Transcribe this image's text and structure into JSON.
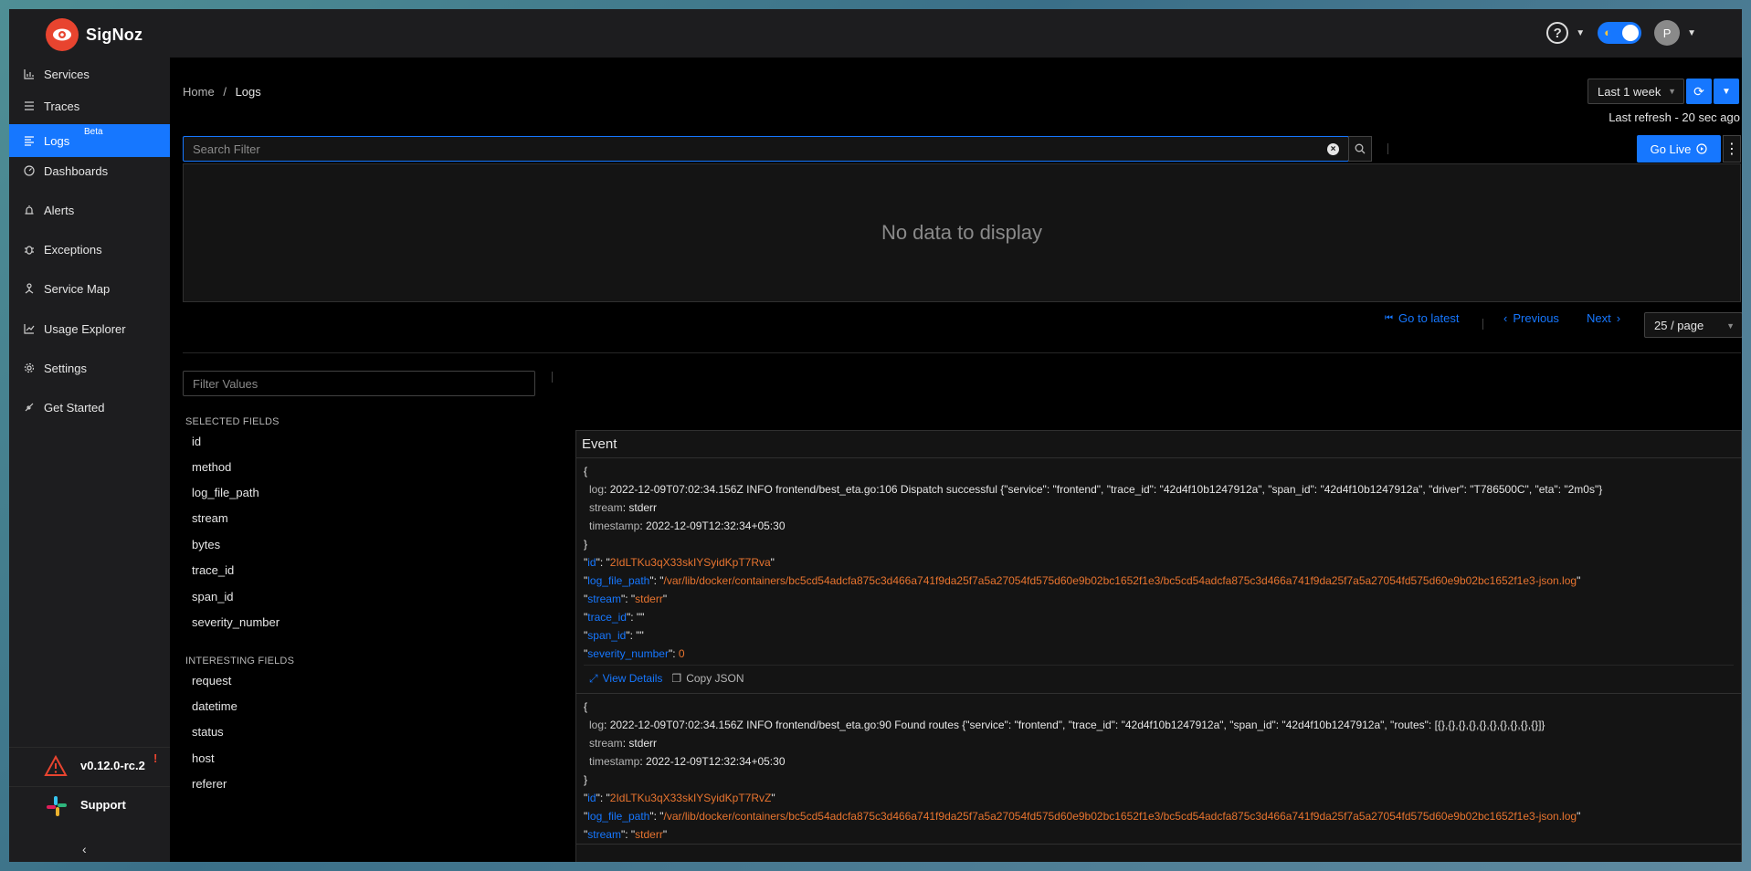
{
  "brand": {
    "name": "SigNoz"
  },
  "topbar": {
    "avatar_initial": "P"
  },
  "sidebar": {
    "items": [
      {
        "label": "Services",
        "icon": "bar-chart-icon"
      },
      {
        "label": "Traces",
        "icon": "list-icon"
      },
      {
        "label": "Logs",
        "icon": "align-left-icon",
        "badge": "Beta"
      },
      {
        "label": "Dashboards",
        "icon": "dashboard-icon"
      },
      {
        "label": "Alerts",
        "icon": "alert-icon"
      },
      {
        "label": "Exceptions",
        "icon": "bug-icon"
      },
      {
        "label": "Service Map",
        "icon": "deployment-icon"
      },
      {
        "label": "Usage Explorer",
        "icon": "line-chart-icon"
      },
      {
        "label": "Settings",
        "icon": "gear-icon"
      },
      {
        "label": "Get Started",
        "icon": "api-icon"
      }
    ],
    "version": "v0.12.0-rc.2",
    "version_flag": "!",
    "support": "Support"
  },
  "breadcrumb": {
    "home": "Home",
    "separator": "/",
    "current": "Logs"
  },
  "time": {
    "selected": "Last 1 week",
    "last_refresh": "Last refresh - 20 sec ago"
  },
  "search": {
    "placeholder": "Search Filter",
    "value": ""
  },
  "go_live": "Go Live",
  "chart": {
    "empty": "No data to display"
  },
  "pager": {
    "latest": "Go to latest",
    "previous": "Previous",
    "next": "Next",
    "page_size": "25 / page"
  },
  "filter": {
    "placeholder": "Filter Values"
  },
  "selected_fields": {
    "heading": "SELECTED FIELDS",
    "items": [
      "id",
      "method",
      "log_file_path",
      "stream",
      "bytes",
      "trace_id",
      "span_id",
      "severity_number"
    ]
  },
  "interesting_fields": {
    "heading": "INTERESTING FIELDS",
    "items": [
      "request",
      "datetime",
      "status",
      "host",
      "referer"
    ]
  },
  "events": {
    "header": "Event",
    "view_details": "View Details",
    "copy_json": "Copy JSON",
    "logs": [
      {
        "log": "2022-12-09T07:02:34.156Z INFO frontend/best_eta.go:106 Dispatch successful {\"service\": \"frontend\", \"trace_id\": \"42d4f10b1247912a\", \"span_id\": \"42d4f10b1247912a\", \"driver\": \"T786500C\", \"eta\": \"2m0s\"}",
        "stream": "stderr",
        "timestamp": "2022-12-09T12:32:34+05:30",
        "id": "2IdLTKu3qX33skIYSyidKpT7Rva",
        "log_file_path": "/var/lib/docker/containers/bc5cd54adcfa875c3d466a741f9da25f7a5a27054fd575d60e9b02bc1652f1e3/bc5cd54adcfa875c3d466a741f9da25f7a5a27054fd575d60e9b02bc1652f1e3-json.log",
        "stream_v": "stderr",
        "trace_id": "",
        "span_id": "",
        "severity_number": "0"
      },
      {
        "log": "2022-12-09T07:02:34.156Z INFO frontend/best_eta.go:90 Found routes {\"service\": \"frontend\", \"trace_id\": \"42d4f10b1247912a\", \"span_id\": \"42d4f10b1247912a\", \"routes\": [{},{},{},{},{},{},{},{},{},{}]}",
        "stream": "stderr",
        "timestamp": "2022-12-09T12:32:34+05:30",
        "id": "2IdLTKu3qX33skIYSyidKpT7RvZ",
        "log_file_path": "/var/lib/docker/containers/bc5cd54adcfa875c3d466a741f9da25f7a5a27054fd575d60e9b02bc1652f1e3/bc5cd54adcfa875c3d466a741f9da25f7a5a27054fd575d60e9b02bc1652f1e3-json.log",
        "stream_v": "stderr"
      }
    ]
  },
  "colors": {
    "accent": "#1677ff",
    "brand": "#e8442f",
    "string_value": "#e8742f"
  }
}
